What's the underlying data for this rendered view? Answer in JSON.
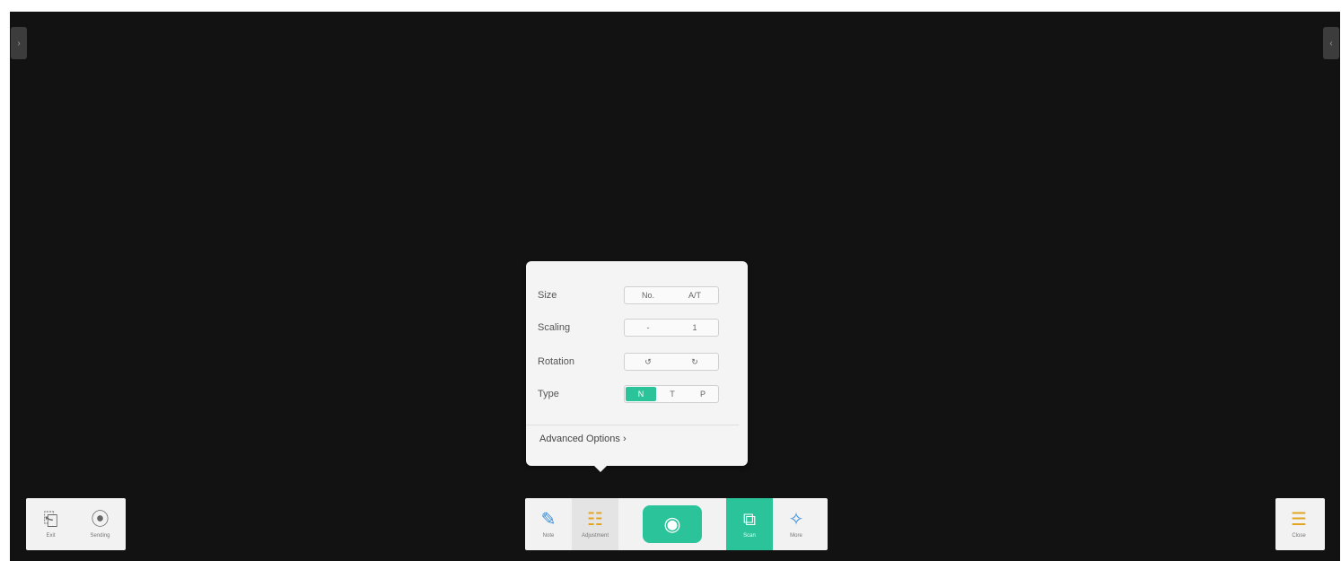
{
  "popup": {
    "rows": [
      {
        "label": "Size",
        "options": [
          "No.",
          "A/T"
        ]
      },
      {
        "label": "Scaling",
        "options": [
          "-",
          "1"
        ]
      },
      {
        "label": "Rotation",
        "options": [
          "↺",
          "↻"
        ]
      },
      {
        "label": "Type",
        "options": [
          "N",
          "T",
          "P"
        ],
        "active_index": 0
      }
    ],
    "advanced_label": "Advanced Options",
    "advanced_arrow": "›"
  },
  "left_toolbar": {
    "items": [
      {
        "label": "Exit",
        "icon": "exit-icon",
        "glyph": "⎗"
      },
      {
        "label": "Sending",
        "icon": "broadcast-icon",
        "glyph": "⦿"
      }
    ]
  },
  "center_toolbar": {
    "items": [
      {
        "label": "Note",
        "icon": "pen-icon",
        "glyph": "✎"
      },
      {
        "label": "Adjustment",
        "icon": "adjust-icon",
        "glyph": "☷"
      },
      {
        "label": "",
        "icon": "camera-icon",
        "glyph": "◉"
      },
      {
        "label": "Scan",
        "icon": "scan-icon",
        "glyph": "⧉"
      },
      {
        "label": "More",
        "icon": "magic-icon",
        "glyph": "✧"
      }
    ]
  },
  "right_toolbar": {
    "label": "Close",
    "icon": "panel-icon",
    "glyph": "☰"
  },
  "colors": {
    "accent": "#2bc39a",
    "background": "#121212",
    "toolbar": "#f2f2f2"
  }
}
